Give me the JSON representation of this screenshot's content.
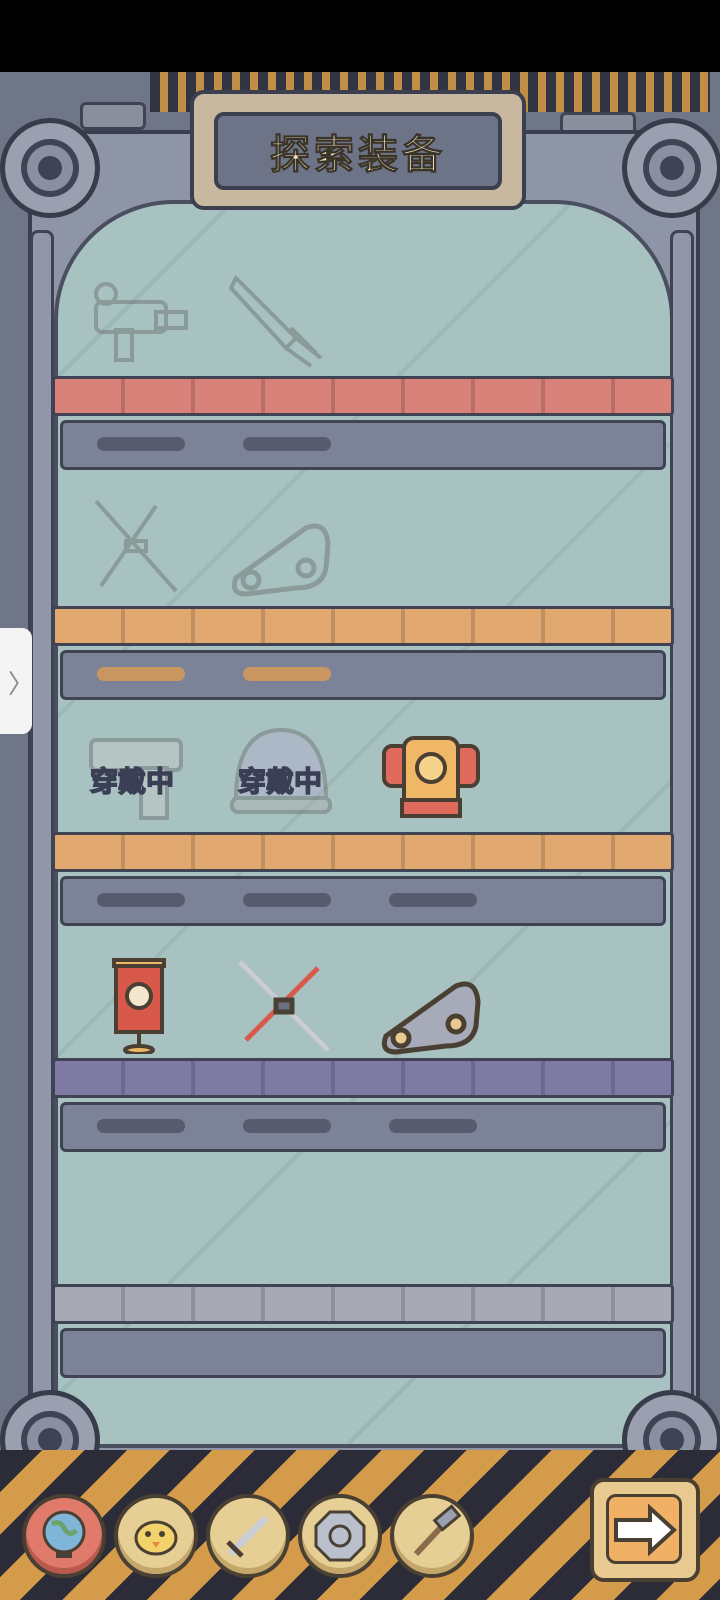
{
  "title": "探索装备",
  "wearing_label": "穿戴中",
  "drawer_tab_glyph": "〉",
  "shelves": [
    {
      "name": "shelf-1",
      "color": "#d8827a",
      "items": [
        {
          "name": "blaster-gun",
          "icon": "blaster-gun-icon",
          "state": "locked"
        },
        {
          "name": "combat-knife",
          "icon": "knife-icon",
          "state": "locked"
        }
      ]
    },
    {
      "name": "shelf-2",
      "color": "#e1a870",
      "items": [
        {
          "name": "crossed-katanas",
          "icon": "crossed-swords-icon",
          "state": "locked"
        },
        {
          "name": "tank-tread",
          "icon": "tank-tread-icon",
          "state": "locked"
        }
      ]
    },
    {
      "name": "shelf-3",
      "color": "#e1a870",
      "items": [
        {
          "name": "pistol",
          "icon": "pistol-icon",
          "state": "wearing"
        },
        {
          "name": "space-helmet",
          "icon": "helmet-icon",
          "state": "wearing"
        },
        {
          "name": "samurai-armor",
          "icon": "armor-icon",
          "state": "owned"
        }
      ]
    },
    {
      "name": "shelf-4",
      "color": "#7e7aa4",
      "items": [
        {
          "name": "war-banner",
          "icon": "banner-icon",
          "state": "owned"
        },
        {
          "name": "crossed-katanas-red",
          "icon": "crossed-swords-icon",
          "state": "owned"
        },
        {
          "name": "tank-tread-owned",
          "icon": "tank-tread-icon",
          "state": "owned"
        }
      ]
    },
    {
      "name": "shelf-5",
      "color": "#a7aab4",
      "items": []
    }
  ],
  "bottom_nav": [
    {
      "name": "globe-button",
      "icon": "globe-icon",
      "active": true
    },
    {
      "name": "chick-button",
      "icon": "chick-icon",
      "active": false
    },
    {
      "name": "sword-button",
      "icon": "sword-icon",
      "active": false
    },
    {
      "name": "shield-button",
      "icon": "octagon-shield-icon",
      "active": false
    },
    {
      "name": "tools-button",
      "icon": "hammer-wrench-icon",
      "active": false
    }
  ],
  "next_button_icon": "right-arrow-icon"
}
